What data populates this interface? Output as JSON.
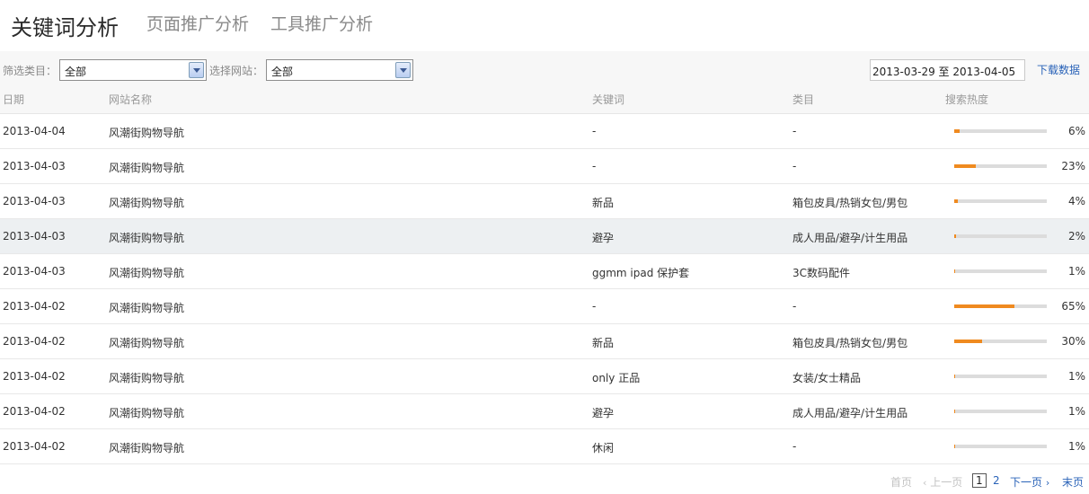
{
  "tabs": [
    {
      "label": "关键词分析",
      "active": true
    },
    {
      "label": "页面推广分析",
      "active": false
    },
    {
      "label": "工具推广分析",
      "active": false
    }
  ],
  "filters": {
    "category_label": "筛选类目：",
    "category_value": "全部",
    "site_label": "选择网站：",
    "site_value": "全部",
    "date_range": "2013-03-29 至 2013-04-05",
    "download_label": "下载数据"
  },
  "table": {
    "headers": [
      "日期",
      "网站名称",
      "关键词",
      "类目",
      "搜索热度"
    ],
    "rows": [
      {
        "date": "2013-04-04",
        "site": "风潮街购物导航",
        "keyword": "-",
        "category": "-",
        "heat": 6,
        "heat_label": "6%"
      },
      {
        "date": "2013-04-03",
        "site": "风潮街购物导航",
        "keyword": "-",
        "category": "-",
        "heat": 23,
        "heat_label": "23%"
      },
      {
        "date": "2013-04-03",
        "site": "风潮街购物导航",
        "keyword": "新品",
        "category": "箱包皮具/热销女包/男包",
        "heat": 4,
        "heat_label": "4%"
      },
      {
        "date": "2013-04-03",
        "site": "风潮街购物导航",
        "keyword": "避孕",
        "category": "成人用品/避孕/计生用品",
        "heat": 2,
        "heat_label": "2%"
      },
      {
        "date": "2013-04-03",
        "site": "风潮街购物导航",
        "keyword": "ggmm ipad 保护套",
        "category": "3C数码配件",
        "heat": 1,
        "heat_label": "1%"
      },
      {
        "date": "2013-04-02",
        "site": "风潮街购物导航",
        "keyword": "-",
        "category": "-",
        "heat": 65,
        "heat_label": "65%"
      },
      {
        "date": "2013-04-02",
        "site": "风潮街购物导航",
        "keyword": "新品",
        "category": "箱包皮具/热销女包/男包",
        "heat": 30,
        "heat_label": "30%"
      },
      {
        "date": "2013-04-02",
        "site": "风潮街购物导航",
        "keyword": "only 正品",
        "category": "女装/女士精品",
        "heat": 1,
        "heat_label": "1%"
      },
      {
        "date": "2013-04-02",
        "site": "风潮街购物导航",
        "keyword": "避孕",
        "category": "成人用品/避孕/计生用品",
        "heat": 1,
        "heat_label": "1%"
      },
      {
        "date": "2013-04-02",
        "site": "风潮街购物导航",
        "keyword": "休闲",
        "category": "-",
        "heat": 1,
        "heat_label": "1%"
      }
    ]
  },
  "pagination": {
    "first": "首页",
    "prev": "上一页",
    "pages": [
      "1",
      "2"
    ],
    "current": "1",
    "next": "下一页",
    "last": "末页"
  },
  "colors": {
    "accent": "#ef8a1f",
    "link": "#2a63b8",
    "track": "#dcdcdc",
    "highlight_row": "#edf0f2"
  },
  "icons": {
    "dropdown": "chevron-down-icon",
    "prev": "chevron-left-icon",
    "next": "chevron-right-icon"
  }
}
